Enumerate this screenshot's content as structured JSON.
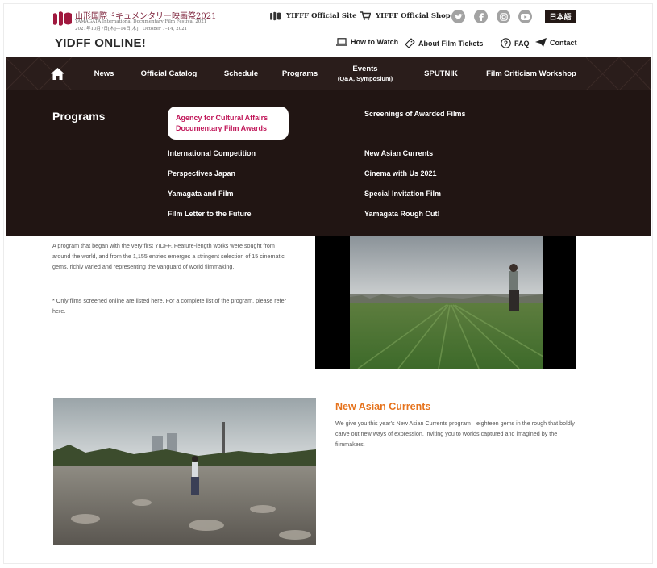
{
  "header": {
    "logo_jp": "山形国際ドキュメンタリー映画祭2021",
    "logo_en": "YAMAGATA International Documentary Film Festival 2021",
    "logo_date": "2021年10月7日[木]―14日[木]　October 7–14, 2021",
    "site_title": "YIDFF ONLINE!",
    "official_site": "YIFFF Official Site",
    "official_shop": "YIFFF Official Shop",
    "language": "日本語",
    "how_to_watch": "How to Watch",
    "film_tickets": "About Film Tickets",
    "faq": "FAQ",
    "contact": "Contact",
    "social_icons": [
      "twitter-icon",
      "facebook-icon",
      "instagram-icon",
      "youtube-icon"
    ]
  },
  "nav": {
    "items": [
      "News",
      "Official Catalog",
      "Schedule",
      "Programs"
    ],
    "events": "Events",
    "events_sub": "(Q&A, Symposium)",
    "sputnik": "SPUTNIK",
    "workshop": "Film Criticism Workshop"
  },
  "dropdown": {
    "heading": "Programs",
    "highlight_line1": "Agency for Cultural Affairs",
    "highlight_line2": "Documentary Film Awards",
    "left": [
      "International Competition",
      "Perspectives Japan",
      "Yamagata and Film",
      "Film Letter to the Future"
    ],
    "right": [
      "Screenings of Awarded Films",
      "New Asian Currents",
      "Cinema with Us 2021",
      "Special Invitation Film",
      "Yamagata Rough Cut!"
    ]
  },
  "main": {
    "intro": "A program that began with the very first YIDFF. Feature-length works were sought from around the world, and from the 1,155 entries emerges a stringent selection of 15 cinematic gems, richly varied and representing the vanguard of world filmmaking.",
    "note": "* Only films screened online are listed here. For a complete list of the program, please refer here.",
    "section_title": "New Asian Currents",
    "section_desc": "We give you this year's New Asian Currents program—eighteen gems in the rough that boldly carve out new ways of expression, inviting you to worlds captured and imagined by the filmmakers."
  },
  "colors": {
    "nav_bg": "#2a1d1b",
    "dropdown_bg": "#211513",
    "highlight_text": "#c1185a",
    "section_title": "#e6731d",
    "logo": "#a0183e"
  }
}
